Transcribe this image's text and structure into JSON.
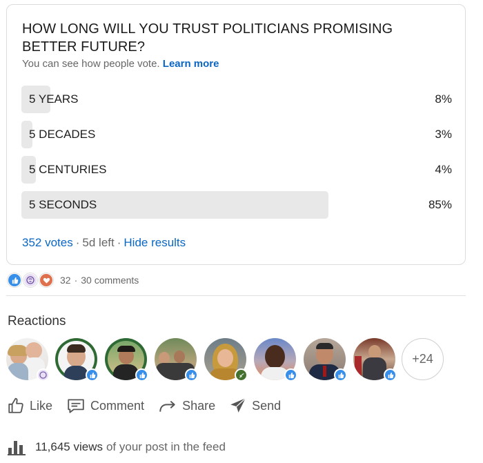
{
  "poll": {
    "question": "HOW LONG WILL YOU TRUST POLITICIANS PROMISING BETTER FUTURE?",
    "subtitle": "You can see how people vote.",
    "learn_more": "Learn more",
    "options": [
      {
        "label": "5 YEARS",
        "percent_text": "8%",
        "percent": 8
      },
      {
        "label": "5 DECADES",
        "percent_text": "3%",
        "percent": 3
      },
      {
        "label": "5 CENTURIES",
        "percent_text": "4%",
        "percent": 4
      },
      {
        "label": "5 SECONDS",
        "percent_text": "85%",
        "percent": 85
      }
    ],
    "votes": "352 votes",
    "time_left": "5d left",
    "hide_results": "Hide results"
  },
  "social": {
    "reaction_count": "32",
    "separator": "·",
    "comments": "30 comments",
    "reaction_icons": [
      "like-icon",
      "insightful-icon",
      "love-icon"
    ]
  },
  "reactions": {
    "title": "Reactions",
    "more_count": "+24",
    "avatars": [
      {
        "badge": "insightful-icon",
        "badge_color": "#6b4fa1"
      },
      {
        "badge": "like-icon",
        "badge_color": "#378fe9"
      },
      {
        "badge": "like-icon",
        "badge_color": "#378fe9"
      },
      {
        "badge": "like-icon",
        "badge_color": "#378fe9"
      },
      {
        "badge": "celebrate-icon",
        "badge_color": "#44712e"
      },
      {
        "badge": "like-icon",
        "badge_color": "#378fe9"
      },
      {
        "badge": "like-icon",
        "badge_color": "#378fe9"
      },
      {
        "badge": "like-icon",
        "badge_color": "#378fe9"
      }
    ]
  },
  "actions": {
    "like": "Like",
    "comment": "Comment",
    "share": "Share",
    "send": "Send"
  },
  "views": {
    "count": "11,645 views",
    "suffix": "of your post in the feed"
  },
  "colors": {
    "accent": "#0a66c2",
    "bar": "#e8e8e8"
  }
}
